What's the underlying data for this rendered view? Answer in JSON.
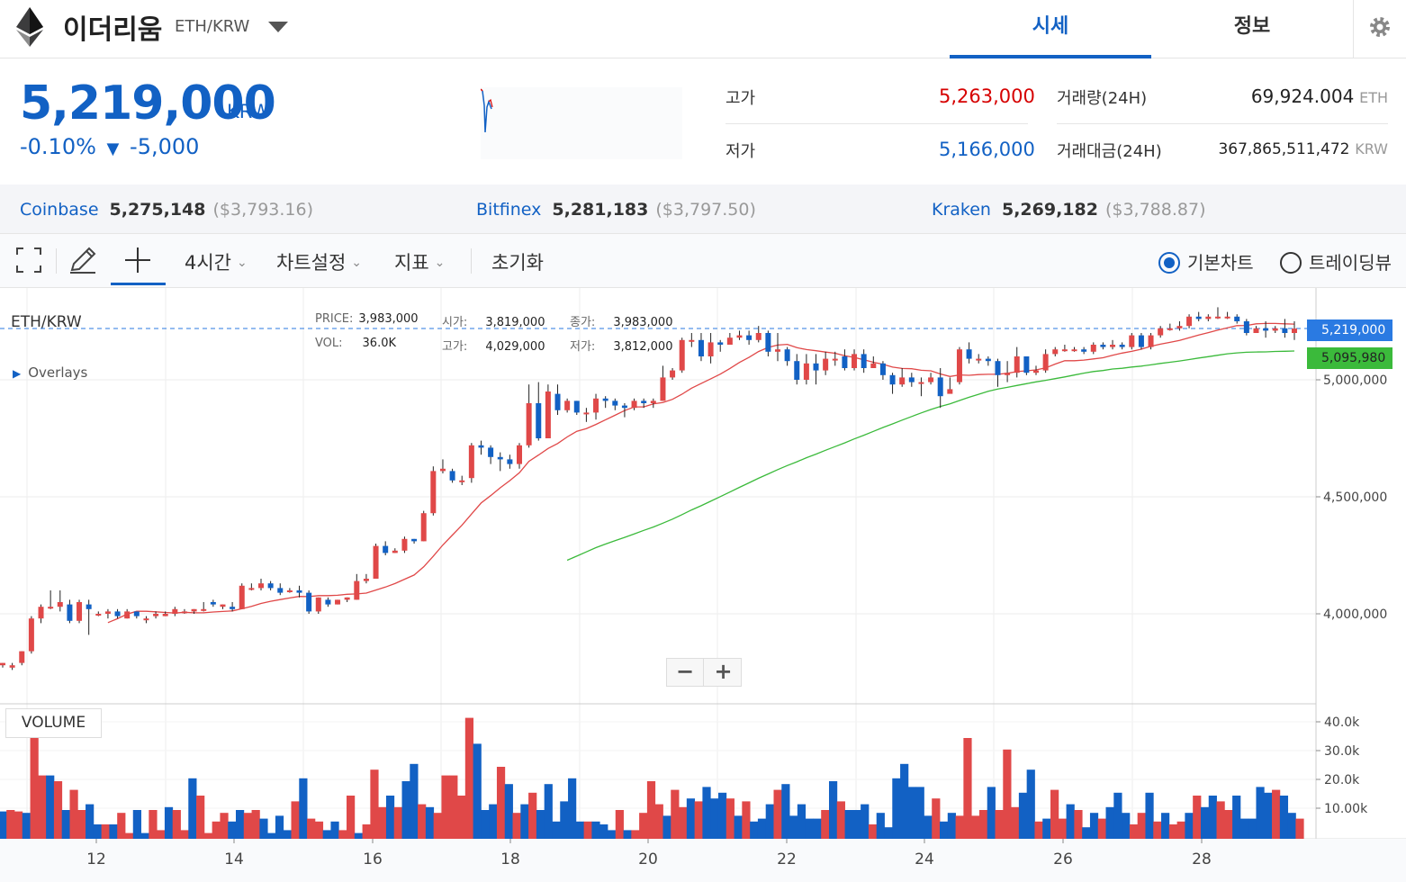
{
  "header": {
    "coin_name": "이더리움",
    "pair": "ETH/KRW",
    "tabs": [
      "시세",
      "정보"
    ]
  },
  "summary": {
    "price": "5,219,000",
    "price_unit": "KRW",
    "change_pct": "-0.10%",
    "change_arrow": "▼",
    "change_abs": "-5,000",
    "high_label": "고가",
    "high_value": "5,263,000",
    "low_label": "저가",
    "low_value": "5,166,000",
    "volume_label": "거래량(24H)",
    "volume_value": "69,924.004",
    "volume_unit": "ETH",
    "amount_label": "거래대금(24H)",
    "amount_value": "367,865,511,472",
    "amount_unit": "KRW"
  },
  "exchanges": [
    {
      "name": "Coinbase",
      "price": "5,275,148",
      "usd": "($3,793.16)"
    },
    {
      "name": "Bitfinex",
      "price": "5,281,183",
      "usd": "($3,797.50)"
    },
    {
      "name": "Kraken",
      "price": "5,269,182",
      "usd": "($3,788.87)"
    }
  ],
  "toolbar": {
    "interval": "4시간",
    "chart_settings": "차트설정",
    "indicators": "지표",
    "reset": "초기화",
    "basic_chart": "기본차트",
    "tradingview": "트레이딩뷰",
    "selected_view": "기본차트"
  },
  "chart": {
    "symbol": "ETH/KRW",
    "overlays": "Overlays",
    "ohlc": {
      "price_label": "PRICE:",
      "price": "3,983,000",
      "open_label": "시가:",
      "open": "3,819,000",
      "close_label": "종가:",
      "close": "3,983,000",
      "vol_label": "VOL:",
      "vol": "36.0K",
      "high_label": "고가:",
      "high": "4,029,000",
      "low_label": "저가:",
      "low": "3,812,000"
    },
    "current_price_flag": "5,219,000",
    "ma_flag": "5,095,980",
    "volume_label": "VOLUME",
    "zoom_out": "−",
    "zoom_in": "+"
  },
  "chart_data": {
    "type": "candlestick",
    "price_axis_ticks": [
      "5,000,000",
      "4,500,000",
      "4,000,000"
    ],
    "volume_axis_ticks": [
      "40.0k",
      "30.0k",
      "20.0k",
      "10.00k"
    ],
    "x_ticks": [
      "12",
      "14",
      "16",
      "18",
      "20",
      "22",
      "24",
      "26",
      "28"
    ],
    "candles": [
      [
        3780000,
        3790000,
        3790000,
        3770000
      ],
      [
        3770000,
        3780000,
        3790000,
        3760000
      ],
      [
        3790000,
        3840000,
        3840000,
        3780000
      ],
      [
        3840000,
        3980000,
        3990000,
        3830000
      ],
      [
        3980000,
        4030000,
        4040000,
        3960000
      ],
      [
        4030000,
        4030000,
        4100000,
        4020000
      ],
      [
        4030000,
        4050000,
        4100000,
        4010000
      ],
      [
        4040000,
        3970000,
        4060000,
        3960000
      ],
      [
        3970000,
        4050000,
        4060000,
        3960000
      ],
      [
        4040000,
        4020000,
        4060000,
        3910000
      ],
      [
        4000000,
        4000000,
        4010000,
        3990000
      ],
      [
        4000000,
        4010000,
        4020000,
        3980000
      ],
      [
        4010000,
        3990000,
        4020000,
        3980000
      ],
      [
        3980000,
        4010000,
        4020000,
        3980000
      ],
      [
        4010000,
        3990000,
        4010000,
        3980000
      ],
      [
        3980000,
        3980000,
        3990000,
        3960000
      ],
      [
        3990000,
        4000000,
        4010000,
        3980000
      ],
      [
        3990000,
        4000000,
        4010000,
        3990000
      ],
      [
        4000000,
        4020000,
        4030000,
        3990000
      ],
      [
        4010000,
        4010000,
        4020000,
        4000000
      ],
      [
        4010000,
        4020000,
        4020000,
        4000000
      ],
      [
        4020000,
        4020000,
        4050000,
        4010000
      ],
      [
        4050000,
        4040000,
        4060000,
        4030000
      ],
      [
        4030000,
        4040000,
        4040000,
        4020000
      ],
      [
        4030000,
        4020000,
        4050000,
        4010000
      ],
      [
        4020000,
        4120000,
        4130000,
        4020000
      ],
      [
        4110000,
        4110000,
        4130000,
        4100000
      ],
      [
        4110000,
        4130000,
        4150000,
        4100000
      ],
      [
        4130000,
        4110000,
        4140000,
        4100000
      ],
      [
        4110000,
        4090000,
        4130000,
        4080000
      ],
      [
        4100000,
        4100000,
        4110000,
        4090000
      ],
      [
        4100000,
        4090000,
        4120000,
        4070000
      ],
      [
        4090000,
        4010000,
        4100000,
        4000000
      ],
      [
        4010000,
        4070000,
        4070000,
        4000000
      ],
      [
        4060000,
        4040000,
        4070000,
        4030000
      ],
      [
        4040000,
        4060000,
        4060000,
        4040000
      ],
      [
        4060000,
        4070000,
        4070000,
        4050000
      ],
      [
        4060000,
        4140000,
        4170000,
        4060000
      ],
      [
        4140000,
        4150000,
        4170000,
        4130000
      ],
      [
        4150000,
        4290000,
        4300000,
        4150000
      ],
      [
        4290000,
        4260000,
        4310000,
        4250000
      ],
      [
        4260000,
        4270000,
        4280000,
        4260000
      ],
      [
        4270000,
        4320000,
        4330000,
        4260000
      ],
      [
        4320000,
        4310000,
        4320000,
        4300000
      ],
      [
        4310000,
        4430000,
        4440000,
        4310000
      ],
      [
        4430000,
        4610000,
        4630000,
        4420000
      ],
      [
        4610000,
        4620000,
        4660000,
        4600000
      ],
      [
        4610000,
        4570000,
        4620000,
        4560000
      ],
      [
        4570000,
        4570000,
        4590000,
        4550000
      ],
      [
        4580000,
        4720000,
        4730000,
        4560000
      ],
      [
        4720000,
        4710000,
        4740000,
        4680000
      ],
      [
        4710000,
        4670000,
        4720000,
        4640000
      ],
      [
        4670000,
        4660000,
        4690000,
        4610000
      ],
      [
        4660000,
        4640000,
        4680000,
        4620000
      ],
      [
        4640000,
        4720000,
        4730000,
        4620000
      ],
      [
        4720000,
        4900000,
        4980000,
        4710000
      ],
      [
        4900000,
        4750000,
        4990000,
        4740000
      ],
      [
        4750000,
        4950000,
        4980000,
        4750000
      ],
      [
        4940000,
        4870000,
        4980000,
        4850000
      ],
      [
        4870000,
        4910000,
        4920000,
        4860000
      ],
      [
        4910000,
        4860000,
        4910000,
        4850000
      ],
      [
        4860000,
        4860000,
        4880000,
        4820000
      ],
      [
        4860000,
        4920000,
        4940000,
        4830000
      ],
      [
        4920000,
        4910000,
        4930000,
        4880000
      ],
      [
        4910000,
        4890000,
        4920000,
        4870000
      ],
      [
        4890000,
        4880000,
        4900000,
        4840000
      ],
      [
        4880000,
        4910000,
        4920000,
        4870000
      ],
      [
        4910000,
        4900000,
        4920000,
        4880000
      ],
      [
        4900000,
        4910000,
        4920000,
        4880000
      ],
      [
        4910000,
        5010000,
        5060000,
        4910000
      ],
      [
        5010000,
        5040000,
        5050000,
        5000000
      ],
      [
        5040000,
        5170000,
        5180000,
        5030000
      ],
      [
        5170000,
        5170000,
        5200000,
        5140000
      ],
      [
        5170000,
        5100000,
        5200000,
        5080000
      ],
      [
        5100000,
        5160000,
        5200000,
        5070000
      ],
      [
        5160000,
        5150000,
        5170000,
        5120000
      ],
      [
        5150000,
        5180000,
        5200000,
        5150000
      ],
      [
        5180000,
        5190000,
        5210000,
        5170000
      ],
      [
        5190000,
        5170000,
        5210000,
        5150000
      ],
      [
        5170000,
        5200000,
        5230000,
        5160000
      ],
      [
        5200000,
        5120000,
        5210000,
        5100000
      ],
      [
        5120000,
        5130000,
        5200000,
        5080000
      ],
      [
        5130000,
        5080000,
        5140000,
        5060000
      ],
      [
        5080000,
        5000000,
        5110000,
        4980000
      ],
      [
        5000000,
        5070000,
        5110000,
        4980000
      ],
      [
        5070000,
        5040000,
        5110000,
        4980000
      ],
      [
        5040000,
        5090000,
        5120000,
        5020000
      ],
      [
        5090000,
        5090000,
        5120000,
        5060000
      ],
      [
        5100000,
        5050000,
        5130000,
        5040000
      ],
      [
        5050000,
        5110000,
        5130000,
        5040000
      ],
      [
        5110000,
        5050000,
        5130000,
        5030000
      ],
      [
        5050000,
        5070000,
        5100000,
        5050000
      ],
      [
        5070000,
        5020000,
        5080000,
        5000000
      ],
      [
        5020000,
        4980000,
        5030000,
        4940000
      ],
      [
        4980000,
        5010000,
        5050000,
        4970000
      ],
      [
        5010000,
        4990000,
        5030000,
        4970000
      ],
      [
        4990000,
        4990000,
        5010000,
        4930000
      ],
      [
        4990000,
        5010000,
        5030000,
        4980000
      ],
      [
        5010000,
        4930000,
        5050000,
        4880000
      ],
      [
        4940000,
        4960000,
        5010000,
        4950000
      ],
      [
        4990000,
        5130000,
        5140000,
        4980000
      ],
      [
        5130000,
        5090000,
        5160000,
        5070000
      ],
      [
        5090000,
        5090000,
        5110000,
        5070000
      ],
      [
        5090000,
        5080000,
        5100000,
        5060000
      ],
      [
        5080000,
        5020000,
        5090000,
        4970000
      ],
      [
        5020000,
        5030000,
        5080000,
        4990000
      ],
      [
        5030000,
        5100000,
        5140000,
        5010000
      ],
      [
        5100000,
        5030000,
        5100000,
        5020000
      ],
      [
        5030000,
        5040000,
        5060000,
        5020000
      ],
      [
        5040000,
        5110000,
        5130000,
        5030000
      ],
      [
        5110000,
        5130000,
        5140000,
        5100000
      ],
      [
        5130000,
        5130000,
        5150000,
        5120000
      ],
      [
        5130000,
        5130000,
        5140000,
        5120000
      ],
      [
        5130000,
        5120000,
        5140000,
        5110000
      ],
      [
        5120000,
        5150000,
        5160000,
        5110000
      ],
      [
        5150000,
        5140000,
        5160000,
        5130000
      ],
      [
        5140000,
        5150000,
        5170000,
        5130000
      ],
      [
        5150000,
        5140000,
        5160000,
        5130000
      ],
      [
        5140000,
        5190000,
        5200000,
        5130000
      ],
      [
        5190000,
        5140000,
        5200000,
        5130000
      ],
      [
        5140000,
        5190000,
        5200000,
        5130000
      ],
      [
        5190000,
        5220000,
        5230000,
        5180000
      ],
      [
        5220000,
        5220000,
        5240000,
        5210000
      ],
      [
        5220000,
        5230000,
        5250000,
        5210000
      ],
      [
        5230000,
        5270000,
        5280000,
        5220000
      ],
      [
        5270000,
        5260000,
        5290000,
        5250000
      ],
      [
        5260000,
        5270000,
        5280000,
        5250000
      ],
      [
        5270000,
        5270000,
        5310000,
        5260000
      ],
      [
        5270000,
        5270000,
        5290000,
        5260000
      ],
      [
        5270000,
        5250000,
        5280000,
        5240000
      ],
      [
        5250000,
        5200000,
        5260000,
        5190000
      ],
      [
        5200000,
        5220000,
        5230000,
        5200000
      ],
      [
        5220000,
        5210000,
        5250000,
        5180000
      ],
      [
        5210000,
        5220000,
        5230000,
        5200000
      ],
      [
        5220000,
        5200000,
        5260000,
        5180000
      ],
      [
        5200000,
        5219000,
        5250000,
        5170000
      ]
    ],
    "volumes": [
      9.5,
      10,
      9.5,
      9,
      36,
      22,
      22,
      20,
      10,
      17,
      10,
      12,
      5,
      5,
      5,
      9,
      2,
      10,
      2,
      10,
      3,
      11,
      10,
      3,
      21,
      15,
      2,
      6,
      9,
      6,
      10,
      9,
      10,
      7,
      2,
      8,
      3,
      13,
      21,
      7,
      6,
      3,
      6,
      3,
      15,
      2,
      5,
      24,
      11,
      15,
      11,
      20,
      26,
      12,
      11,
      9,
      22,
      22,
      15,
      42,
      33,
      10,
      12,
      25,
      19,
      9,
      12,
      16,
      10,
      19,
      6,
      13,
      21,
      6,
      6,
      6,
      5,
      3,
      10,
      3,
      3,
      9,
      20,
      12,
      8,
      17,
      11,
      14,
      13,
      18,
      14,
      16,
      14,
      8,
      13,
      6,
      7,
      12,
      17,
      19,
      8,
      12,
      7,
      7,
      10,
      20,
      13,
      10,
      10,
      12,
      5,
      9,
      4,
      21,
      26,
      18,
      18,
      8,
      14,
      6,
      9,
      8,
      35,
      8,
      10,
      18,
      10,
      31,
      11,
      16,
      24,
      6,
      7,
      17,
      7,
      12,
      10,
      4,
      9,
      7,
      11,
      16,
      9,
      5,
      9,
      16,
      6,
      9,
      5,
      6,
      9,
      15,
      11,
      15,
      13,
      10,
      15,
      7,
      7,
      18,
      16,
      17,
      15,
      9,
      7
    ],
    "ma_short_color": "#e04848",
    "ma_long_color": "#3bba3b",
    "up_color": "#e04848",
    "down_color": "#1261c4"
  }
}
